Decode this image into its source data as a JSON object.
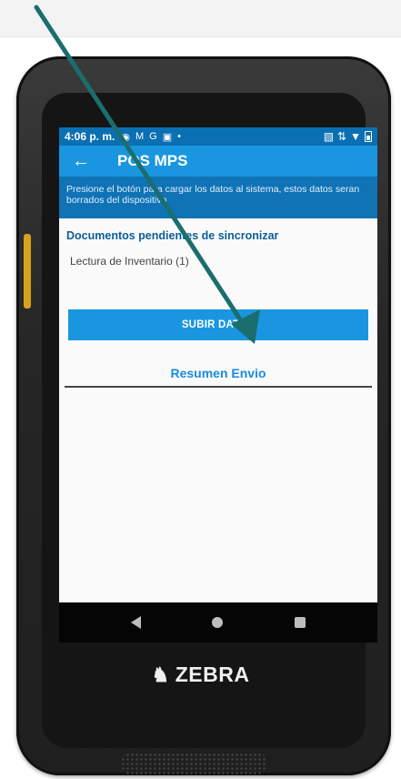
{
  "status_bar": {
    "time": "4:06 p. m.",
    "icons": [
      "chrome-icon",
      "gmail-icon",
      "google-icon",
      "message-icon",
      "dot-icon"
    ],
    "right_icons": [
      "cast-icon",
      "signal-icon",
      "wifi-icon",
      "battery-icon"
    ]
  },
  "app_bar": {
    "back_icon": "arrow-left-icon",
    "title": "POS MPS"
  },
  "instruction_text": "Presione el botón para cargar los datos al sistema, estos datos seran borrados del dispositivo",
  "pending": {
    "section_title": "Documentos pendientes de sincronizar",
    "items": [
      "Lectura de Inventario (1)"
    ]
  },
  "upload_button_label": "SUBIR DATOS",
  "summary_title": "Resumen Envio",
  "nav_bar": {
    "back": "nav-back-icon",
    "home": "nav-home-icon",
    "recents": "nav-recents-icon"
  },
  "brand": {
    "logo_icon": "zebra-head-icon",
    "name": "ZEBRA"
  },
  "annotation": {
    "arrow_color": "#1b6e6e"
  }
}
